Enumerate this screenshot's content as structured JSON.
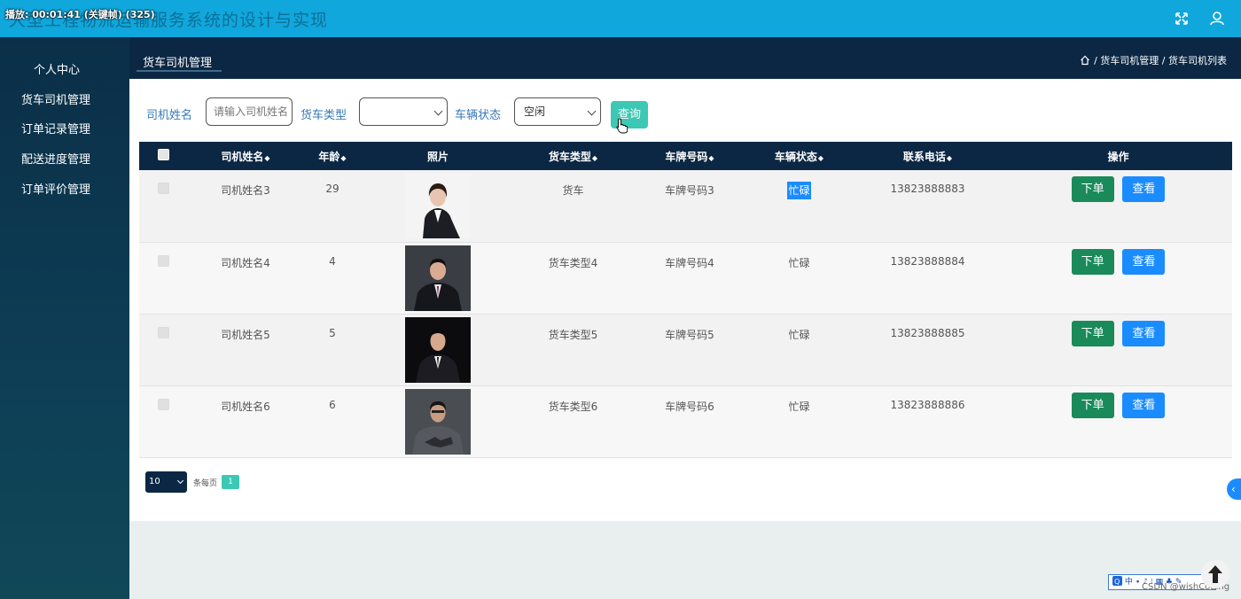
{
  "topbar": {
    "title": "大型工程物流运输服务系统的设计与实现",
    "recording_overlay": "播放: 00:01:41 (关键帧) (325)",
    "fullscreen_icon": "fullscreen-icon",
    "user_icon": "user-icon"
  },
  "sidebar": {
    "items": [
      {
        "label": "个人中心"
      },
      {
        "label": "货车司机管理"
      },
      {
        "label": "订单记录管理"
      },
      {
        "label": "配送进度管理"
      },
      {
        "label": "订单评价管理"
      }
    ]
  },
  "header": {
    "tab_label": "货车司机管理",
    "breadcrumb": {
      "home_icon": "home-icon",
      "path": "/ 货车司机管理 / 货车司机列表"
    }
  },
  "search": {
    "name_label": "司机姓名",
    "name_placeholder": "请输入司机姓名",
    "truck_type_label": "货车类型",
    "truck_type_value": "",
    "status_label": "车辆状态",
    "status_value": "空闲",
    "query_button": "查询"
  },
  "table": {
    "headers": [
      "司机姓名",
      "年龄",
      "照片",
      "货车类型",
      "车牌号码",
      "车辆状态",
      "联系电话",
      "操作"
    ],
    "sort_icon": "◆",
    "rows": [
      {
        "name": "司机姓名3",
        "age": "29",
        "truck_type": "货车",
        "plate": "车牌号码3",
        "status": "忙碌",
        "phone": "13823888883"
      },
      {
        "name": "司机姓名4",
        "age": "4",
        "truck_type": "货车类型4",
        "plate": "车牌号码4",
        "status": "忙碌",
        "phone": "13823888884"
      },
      {
        "name": "司机姓名5",
        "age": "5",
        "truck_type": "货车类型5",
        "plate": "车牌号码5",
        "status": "忙碌",
        "phone": "13823888885"
      },
      {
        "name": "司机姓名6",
        "age": "6",
        "truck_type": "货车类型6",
        "plate": "车牌号码6",
        "status": "忙碌",
        "phone": "13823888886"
      }
    ],
    "order_button": "下单",
    "view_button": "查看"
  },
  "pagination": {
    "page_size": "10",
    "per_page_label": "条每页",
    "current_page": "1"
  },
  "overlays": {
    "ime_bar": "中 ∙ ♪ ⁝ ▦ ♣ ✎",
    "watermark": "CSDN @wishCoding"
  },
  "colors": {
    "topbar": "#10a7dc",
    "header": "#0b2744",
    "accent_teal": "#3cc8b4",
    "order_green": "#1b8a5a",
    "view_blue": "#1b8cff"
  }
}
